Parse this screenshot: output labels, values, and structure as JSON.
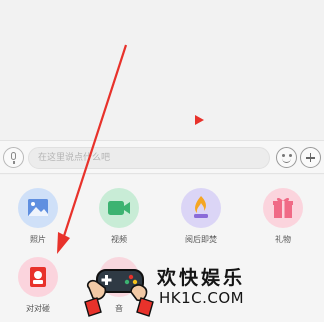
{
  "input_bar": {
    "placeholder": "在这里说点什么吧"
  },
  "actions": [
    {
      "label": "照片",
      "icon": "photo-icon",
      "color": "#cfe0f8"
    },
    {
      "label": "视频",
      "icon": "video-camera-icon",
      "color": "#c8ecd6"
    },
    {
      "label": "阅后即焚",
      "icon": "flame-icon",
      "color": "#dbd5f6"
    },
    {
      "label": "礼物",
      "icon": "gift-icon",
      "color": "#fbd4dd"
    },
    {
      "label": "对对碰",
      "icon": "duidui-icon",
      "color": "#fbd4dd"
    },
    {
      "label": "音",
      "icon": "music-icon",
      "color": "#f8d7de"
    }
  ],
  "watermark": {
    "title": "欢快娱乐",
    "domain": "HK1C.COM"
  },
  "colors": {
    "arrow": "#e8322b",
    "play_indicator": "#e8322b"
  }
}
